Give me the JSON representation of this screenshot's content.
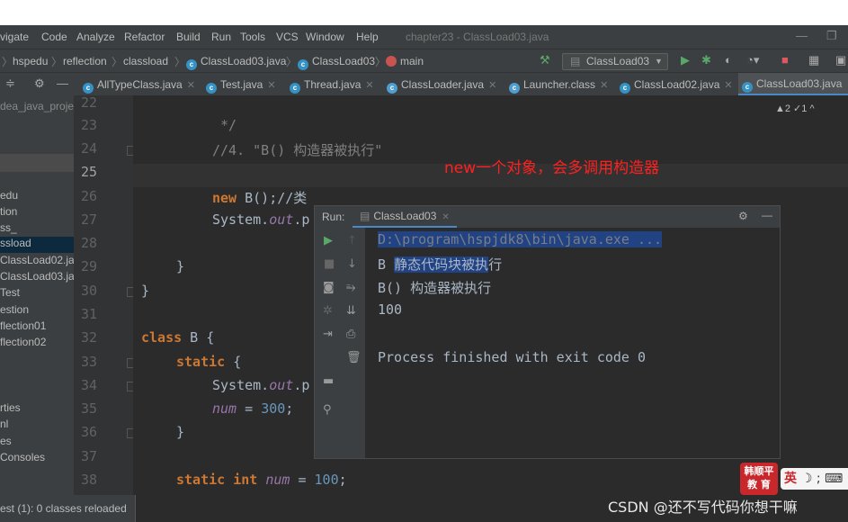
{
  "menu": {
    "items": [
      "vigate",
      "Code",
      "Analyze",
      "Refactor",
      "Build",
      "Run",
      "Tools",
      "VCS",
      "Window",
      "Help"
    ],
    "window_title": "chapter23 - ClassLoad03.java"
  },
  "breadcrumb": {
    "items": [
      "hspedu",
      "reflection",
      "classload",
      "ClassLoad03.java",
      "ClassLoad03",
      "main"
    ],
    "run_config": "ClassLoad03"
  },
  "tabs": [
    {
      "label": "AllTypeClass.java"
    },
    {
      "label": "Test.java"
    },
    {
      "label": "Thread.java"
    },
    {
      "label": "ClassLoader.java"
    },
    {
      "label": "Launcher.class"
    },
    {
      "label": "ClassLoad02.java"
    },
    {
      "label": "ClassLoad03.java"
    }
  ],
  "project": {
    "header": "dea_java_proje",
    "items": [
      "edu",
      "tion",
      "ss_",
      "ssload",
      "ClassLoad02.ja",
      "ClassLoad03.ja",
      "Test",
      "estion",
      "flection01",
      "flection02",
      "rties",
      "nl",
      "es",
      "Consoles"
    ]
  },
  "editor": {
    "line_numbers": [
      "22",
      "23",
      "24",
      "25",
      "26",
      "27",
      "28",
      "29",
      "30",
      "31",
      "32",
      "33",
      "34",
      "35",
      "36",
      "37",
      "38"
    ],
    "lines": {
      "l23": "*/",
      "l24": "//4. \"B() 构造器被执行\"",
      "l26a": "new",
      "l26b": " B();//类",
      "l27a": "System.",
      "l27b": "out",
      "l27c": ".p",
      "l29": "}",
      "l30": "}",
      "l32a": "class",
      "l32b": " B {",
      "l33a": "static",
      "l33b": " {",
      "l34a": "System.",
      "l34b": "out",
      "l34c": ".p",
      "l35a": "num",
      "l35b": " = ",
      "l35c": "300",
      "l35d": ";",
      "l36": "}",
      "l38a": "static int",
      "l38b": " num",
      "l38c": " = ",
      "l38d": "100",
      "l38e": ";"
    },
    "annotation": "new一个对象，会多调用构造器",
    "inspections": "▲2  ✓1  ^"
  },
  "run": {
    "label": "Run:",
    "tab": "ClassLoad03",
    "output": {
      "cmd": "D:\\program\\hspjdk8\\bin\\java.exe ...",
      "line1_prefix": "B ",
      "line1_highlight": "静态代码块被执",
      "line1_suffix": "行",
      "line2": "B() 构造器被执行",
      "line3": "100",
      "line4": "Process finished with exit code 0"
    }
  },
  "status": {
    "text": "est (1): 0 classes reloaded"
  },
  "watermark": {
    "text": "CSDN @还不写代码你想干嘛"
  },
  "badge": {
    "line1": "韩顺平",
    "line2": "教 育"
  },
  "ime": {
    "label": "英",
    "extra": "☽ ; ⌨"
  },
  "colors": {
    "annotation": "#ff2020",
    "keyword": "#cc7832",
    "field": "#9876aa",
    "number": "#6897bb",
    "selection": "#214283"
  }
}
